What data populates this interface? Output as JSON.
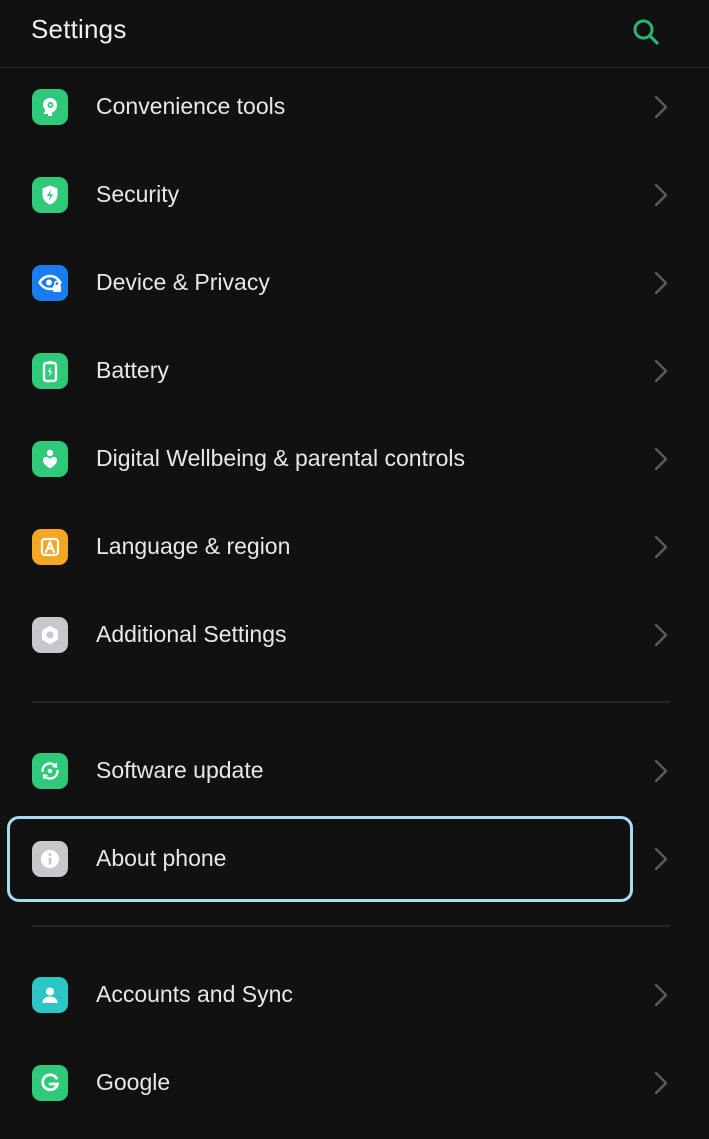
{
  "header": {
    "title": "Settings",
    "search_icon": "search-icon"
  },
  "colors": {
    "background": "#111111",
    "accent": "#2bb56f",
    "highlight": "#a8dcec"
  },
  "groups": [
    {
      "items": [
        {
          "label": "Convenience tools",
          "icon": "convenience-tools-icon",
          "color": "#2fc97a"
        },
        {
          "label": "Security",
          "icon": "shield-icon",
          "color": "#2fc97a"
        },
        {
          "label": "Device & Privacy",
          "icon": "privacy-eye-icon",
          "color": "#1b7cf2"
        },
        {
          "label": "Battery",
          "icon": "battery-icon",
          "color": "#2fc97a"
        },
        {
          "label": "Digital Wellbeing & parental controls",
          "icon": "wellbeing-icon",
          "color": "#2fc97a"
        },
        {
          "label": "Language & region",
          "icon": "language-icon",
          "color": "#f5a623"
        },
        {
          "label": "Additional Settings",
          "icon": "gear-icon",
          "color": "#c8c8cc"
        }
      ]
    },
    {
      "items": [
        {
          "label": "Software update",
          "icon": "update-icon",
          "color": "#2fc97a"
        },
        {
          "label": "About phone",
          "icon": "info-icon",
          "color": "#c8c8cc",
          "highlighted": true
        }
      ]
    },
    {
      "items": [
        {
          "label": "Accounts and Sync",
          "icon": "account-icon",
          "color": "#2cc6c6"
        },
        {
          "label": "Google",
          "icon": "google-icon",
          "color": "#2fc97a"
        }
      ]
    }
  ]
}
